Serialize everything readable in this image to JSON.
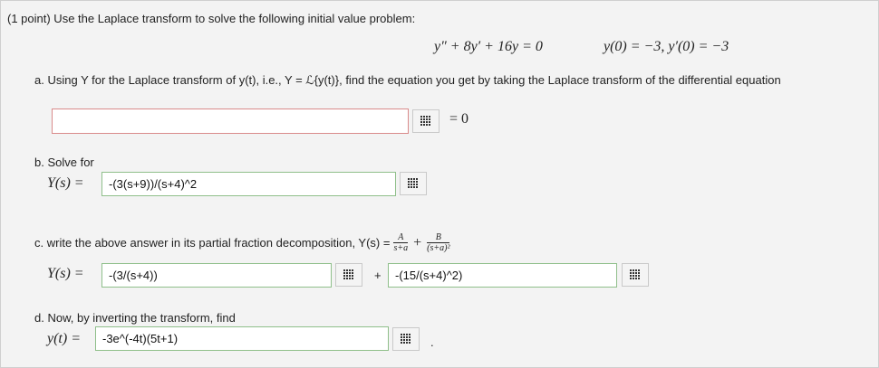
{
  "header": {
    "text": "(1 point) Use the Laplace transform to solve the following initial value problem:"
  },
  "equation": {
    "ode": "y″ + 8y′ + 16y = 0",
    "initial": "y(0) = −3,  y′(0) = −3"
  },
  "part_a": {
    "prompt": "a. Using Y for the Laplace transform of y(t), i.e., Y = ℒ{y(t)}, find the equation you get by taking the Laplace transform of the differential equation",
    "value": "",
    "suffix": "= 0"
  },
  "part_b": {
    "prompt": "b. Solve for",
    "lhs": "Y(s) =",
    "value": "-(3(s+9))/(s+4)^2"
  },
  "part_c": {
    "prompt": "c. write the above answer in its partial fraction decomposition, Y(s) =",
    "frac1_num": "A",
    "frac1_den": "s+a",
    "plus": "+",
    "frac2_num": "B",
    "frac2_den": "(s+a)²",
    "lhs": "Y(s) =",
    "value1": "-(3/(s+4))",
    "value2": "-(15/(s+4)^2)"
  },
  "part_d": {
    "prompt": "d. Now, by inverting the transform, find",
    "lhs": "y(t) =",
    "value": "-3e^(-4t)(5t+1)",
    "tail": "."
  },
  "icons": {
    "equation_editor": "grid-icon"
  }
}
